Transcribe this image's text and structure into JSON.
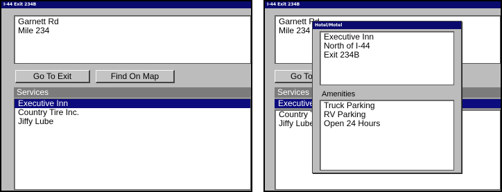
{
  "left_screen": {
    "title": "I-44 Exit 234B",
    "info_lines": [
      "Garnett Rd",
      "Mile 234"
    ],
    "go_to_exit_label": "Go To Exit",
    "find_on_map_label": "Find On Map",
    "services_header": "Services",
    "services": [
      "Executive Inn",
      "Country Tire Inc.",
      "Jiffy Lube"
    ],
    "selected_service": "Executive Inn"
  },
  "right_screen": {
    "title": "I-44 Exit 234B",
    "info_lines": [
      "Garnett Rd",
      "Mile 234"
    ],
    "go_to_exit_label_visible": "Go To",
    "services_header_visible": "Services",
    "services_visible": [
      "Executive",
      "Country T",
      "Jiffy Lube"
    ],
    "popup": {
      "title": "Hotel/Motel",
      "details": [
        "Executive Inn",
        "North of I-44",
        "Exit 234B"
      ],
      "amenities_header": "Amenities",
      "amenities": [
        "Truck Parking",
        "RV Parking",
        "Open 24 Hours"
      ]
    }
  },
  "colors": {
    "titlebar": "#0a0a6e",
    "selection": "#0c0c7e",
    "panel": "#bcbcbc",
    "section_header": "#7c7c7c"
  }
}
